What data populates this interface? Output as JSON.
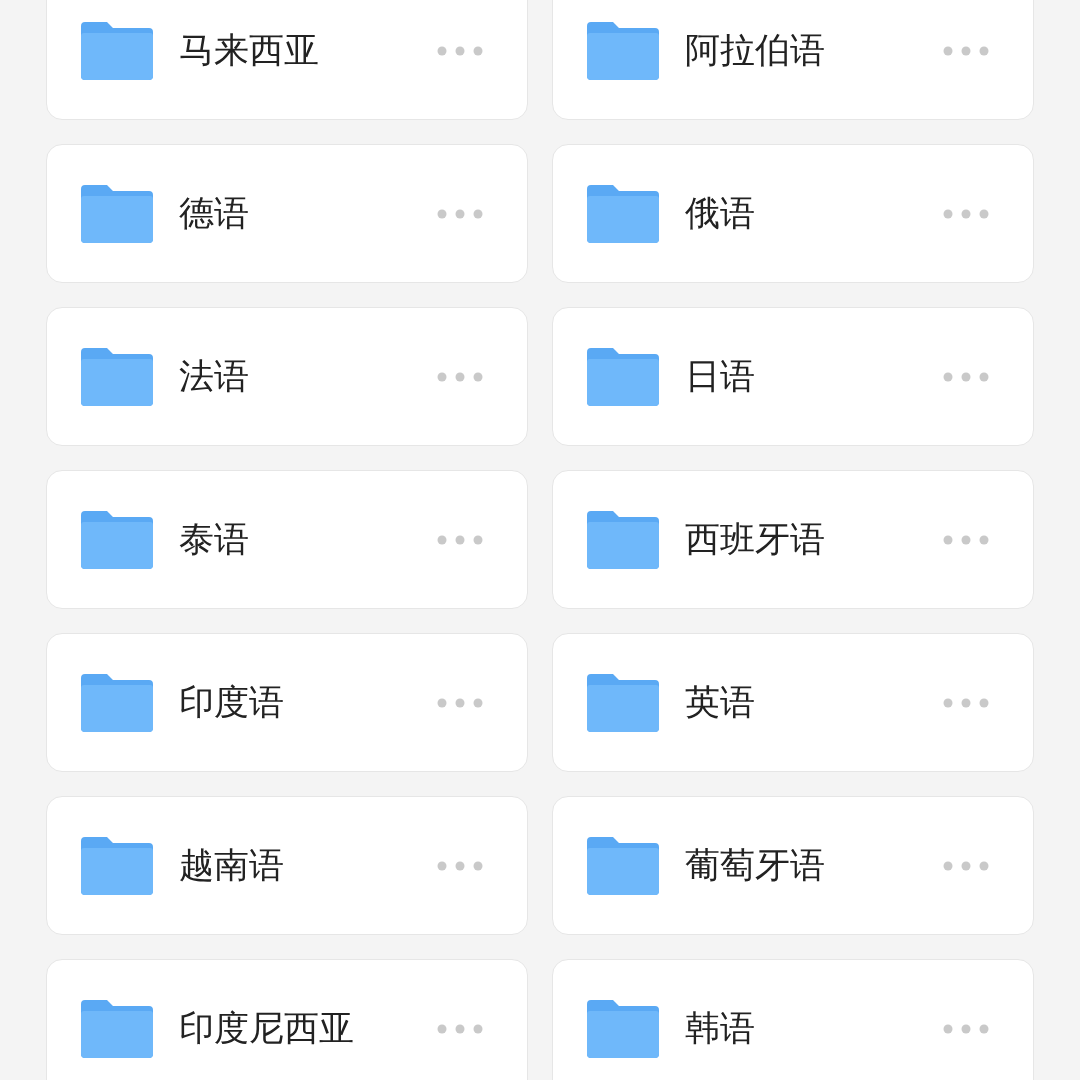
{
  "folders": [
    {
      "name": "马来西亚"
    },
    {
      "name": "阿拉伯语"
    },
    {
      "name": "德语"
    },
    {
      "name": "俄语"
    },
    {
      "name": "法语"
    },
    {
      "name": "日语"
    },
    {
      "name": "泰语"
    },
    {
      "name": "西班牙语"
    },
    {
      "name": "印度语"
    },
    {
      "name": "英语"
    },
    {
      "name": "越南语"
    },
    {
      "name": "葡萄牙语"
    },
    {
      "name": "印度尼西亚"
    },
    {
      "name": "韩语"
    }
  ]
}
